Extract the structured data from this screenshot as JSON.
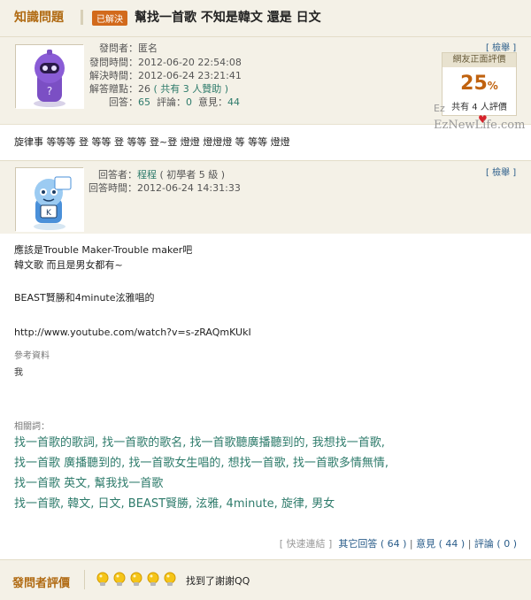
{
  "header": {
    "section_label": "知識問題",
    "resolved_badge": "已解決",
    "title": "幫找一首歌 不知是韓文 還是 日文"
  },
  "question_info": {
    "asker_key": "發問者：",
    "asker_val": "匿名",
    "asked_key": "發問時間：",
    "asked_val": "2012-06-20 22:54:08",
    "solved_key": "解決時間：",
    "solved_val": "2012-06-24 23:21:41",
    "points_key": "解答贈點：",
    "points_val": "26",
    "points_note": "( 共有 3 人贊助 )",
    "answers_key": "回答：",
    "answers_val": "65",
    "comments_key": "評論：",
    "comments_val": "0",
    "opinions_key": "意見：",
    "opinions_val": "44",
    "report_label": "[ 檢舉 ]"
  },
  "rating": {
    "head": "網友正面評價",
    "value": "25",
    "unit": "%",
    "foot": "共有 4 人評價"
  },
  "watermark": {
    "line1": "Ez",
    "line2": "EzNewLife.com"
  },
  "question_body": "旋律事 等等等 登 等等 登 等等 登~登 燈燈 燈燈燈 等 等等 燈燈",
  "answer_info": {
    "answerer_key": "回答者：",
    "answerer_val": "程程",
    "answerer_level": "( 初學者 5 級 )",
    "time_key": "回答時間：",
    "time_val": "2012-06-24 14:31:33",
    "report_label": "[ 檢舉 ]"
  },
  "answer_body": {
    "line1": "應該是Trouble Maker-Trouble maker吧",
    "line2": "韓文歌 而且是男女都有~",
    "line3": "BEAST賢勝和4minute泫雅唱的",
    "line4": "http://www.youtube.com/watch?v=s-zRAQmKUkI"
  },
  "reference": {
    "label": "參考資料",
    "value": "我"
  },
  "related": {
    "label": "相關詞：",
    "line1": "找一首歌的歌詞, 找一首歌的歌名, 找一首歌聽廣播聽到的, 我想找一首歌,",
    "line2": "找一首歌 廣播聽到的, 找一首歌女生唱的, 想找一首歌, 找一首歌多情無情,",
    "line3": "找一首歌 英文, 幫我找一首歌",
    "line4": "找一首歌, 韓文, 日文, BEAST賢勝, 泫雅, 4minute, 旋律, 男女"
  },
  "footer_links": {
    "quick_link": "[ 快速連結 ]",
    "other_answers": "其它回答 ( 64 )",
    "divider1": "|",
    "opinions": "意見 ( 44 )",
    "divider2": "|",
    "comments": "評論 ( 0 )"
  },
  "asker_eval": {
    "label": "發問者評價",
    "bulb_count": 5,
    "comment": "找到了謝謝QQ"
  },
  "colors": {
    "accent_orange": "#b06a12",
    "badge_orange": "#d26a1c",
    "link_green": "#2e7b6b",
    "panel_bg": "#f4f1e7"
  }
}
